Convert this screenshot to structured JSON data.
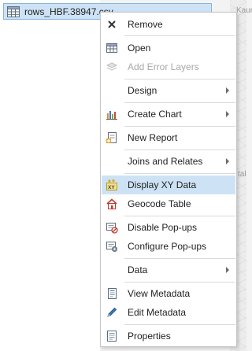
{
  "contents": {
    "selected_table": "rows_HBF.38947.csv"
  },
  "map": {
    "label_top": "Kaur",
    "label_mid": "tal"
  },
  "menu": {
    "items": [
      {
        "label": "Remove",
        "icon": "remove-icon",
        "enabled": true
      },
      {
        "label": "Open",
        "icon": "table-icon",
        "enabled": true
      },
      {
        "label": "Add Error Layers",
        "icon": "error-layers-icon",
        "enabled": false
      },
      {
        "label": "Design",
        "submenu": true,
        "enabled": true
      },
      {
        "label": "Create Chart",
        "icon": "chart-icon",
        "submenu": true,
        "enabled": true
      },
      {
        "label": "New Report",
        "icon": "report-icon",
        "enabled": true
      },
      {
        "label": "Joins and Relates",
        "submenu": true,
        "enabled": true
      },
      {
        "label": "Display XY Data",
        "icon": "xy-data-icon",
        "enabled": true,
        "highlighted": true
      },
      {
        "label": "Geocode Table",
        "icon": "geocode-icon",
        "enabled": true
      },
      {
        "label": "Disable Pop-ups",
        "icon": "disable-popups-icon",
        "enabled": true
      },
      {
        "label": "Configure Pop-ups",
        "icon": "configure-popups-icon",
        "enabled": true
      },
      {
        "label": "Data",
        "submenu": true,
        "enabled": true
      },
      {
        "label": "View Metadata",
        "icon": "view-metadata-icon",
        "enabled": true
      },
      {
        "label": "Edit Metadata",
        "icon": "edit-metadata-icon",
        "enabled": true
      },
      {
        "label": "Properties",
        "icon": "properties-icon",
        "enabled": true
      }
    ]
  },
  "colors": {
    "highlight": "#cde3f5",
    "selection_border": "#84b4de"
  }
}
